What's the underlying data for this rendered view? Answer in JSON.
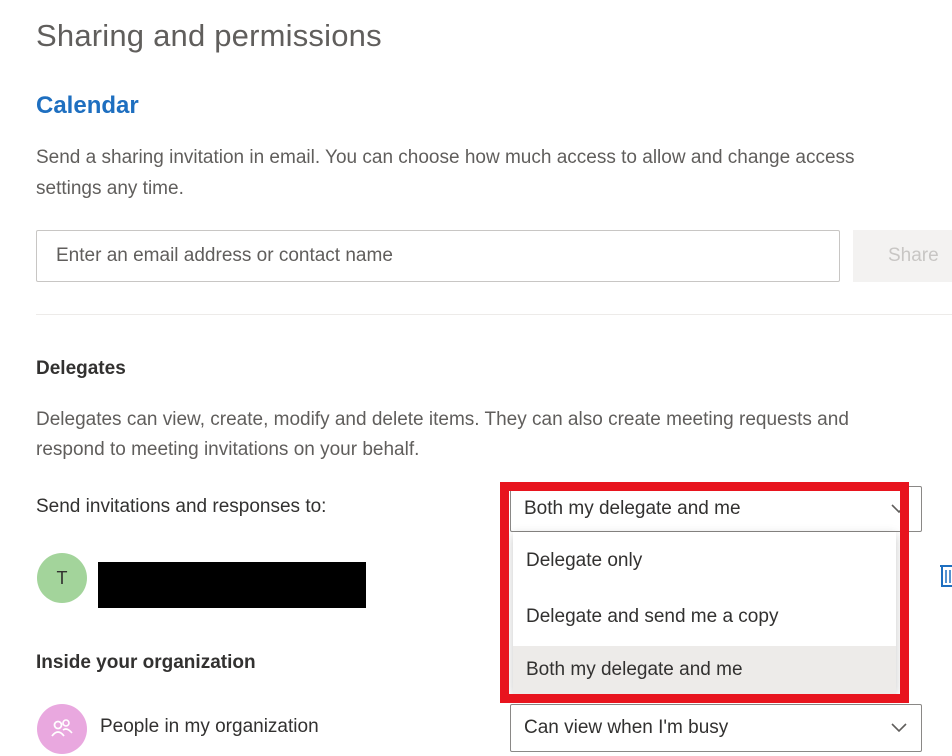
{
  "page": {
    "title": "Sharing and permissions"
  },
  "calendar": {
    "section_title": "Calendar",
    "description_line1": "Send a sharing invitation in email. You can choose how much access to allow and change access",
    "description_line2": "settings any time.",
    "email_input": {
      "value": "",
      "placeholder": "Enter an email address or contact name"
    },
    "share_button_label": "Share"
  },
  "delegates": {
    "title": "Delegates",
    "description_line1": "Delegates can view, create, modify and delete items. They can also create meeting requests and",
    "description_line2": "respond to meeting invitations on your behalf.",
    "send_invitations_label": "Send invitations and responses to:",
    "send_invitations_value": "Both my delegate and me",
    "dropdown_options": [
      {
        "label": "Delegate only",
        "selected": false
      },
      {
        "label": "Delegate and send me a copy",
        "selected": false
      },
      {
        "label": "Both my delegate and me",
        "selected": true
      }
    ],
    "delegate_user": {
      "initial": "T",
      "avatar_color": "#a3d49b",
      "remove_icon": "trash-icon"
    }
  },
  "organization": {
    "title": "Inside your organization",
    "people_label": "People in my organization",
    "people_permission": "Can view when I'm busy",
    "people_avatar_color": "#e9a8df",
    "people_icon": "people-icon"
  },
  "colors": {
    "accent": "#1e6fc0",
    "highlight_box": "#e8141e",
    "selected_option_bg": "#edebe9"
  }
}
